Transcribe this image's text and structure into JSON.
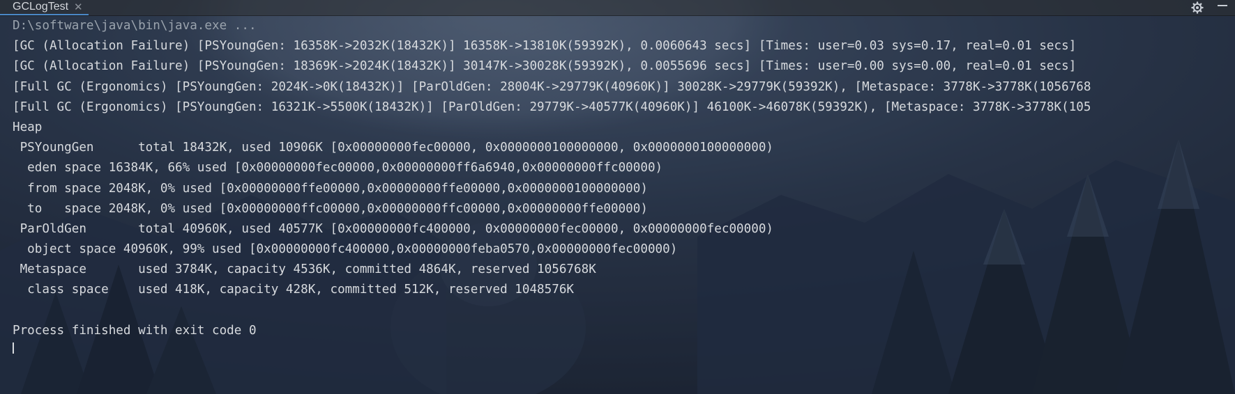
{
  "tab": {
    "title": "GCLogTest"
  },
  "icons": {
    "tab_close": "close-icon",
    "settings": "gear-icon",
    "minimize": "minimize-icon"
  },
  "colors": {
    "console_text": "#d7dade",
    "command_text": "#9aa3ad",
    "tab_underline": "#4a88c7"
  },
  "console": {
    "lines": [
      "D:\\software\\java\\bin\\java.exe ...",
      "[GC (Allocation Failure) [PSYoungGen: 16358K->2032K(18432K)] 16358K->13810K(59392K), 0.0060643 secs] [Times: user=0.03 sys=0.17, real=0.01 secs]",
      "[GC (Allocation Failure) [PSYoungGen: 18369K->2024K(18432K)] 30147K->30028K(59392K), 0.0055696 secs] [Times: user=0.00 sys=0.00, real=0.01 secs]",
      "[Full GC (Ergonomics) [PSYoungGen: 2024K->0K(18432K)] [ParOldGen: 28004K->29779K(40960K)] 30028K->29779K(59392K), [Metaspace: 3778K->3778K(1056768",
      "[Full GC (Ergonomics) [PSYoungGen: 16321K->5500K(18432K)] [ParOldGen: 29779K->40577K(40960K)] 46100K->46078K(59392K), [Metaspace: 3778K->3778K(105",
      "Heap",
      " PSYoungGen      total 18432K, used 10906K [0x00000000fec00000, 0x0000000100000000, 0x0000000100000000)",
      "  eden space 16384K, 66% used [0x00000000fec00000,0x00000000ff6a6940,0x00000000ffc00000)",
      "  from space 2048K, 0% used [0x00000000ffe00000,0x00000000ffe00000,0x0000000100000000)",
      "  to   space 2048K, 0% used [0x00000000ffc00000,0x00000000ffc00000,0x00000000ffe00000)",
      " ParOldGen       total 40960K, used 40577K [0x00000000fc400000, 0x00000000fec00000, 0x00000000fec00000)",
      "  object space 40960K, 99% used [0x00000000fc400000,0x00000000feba0570,0x00000000fec00000)",
      " Metaspace       used 3784K, capacity 4536K, committed 4864K, reserved 1056768K",
      "  class space    used 418K, capacity 428K, committed 512K, reserved 1048576K",
      "",
      "Process finished with exit code 0"
    ]
  }
}
